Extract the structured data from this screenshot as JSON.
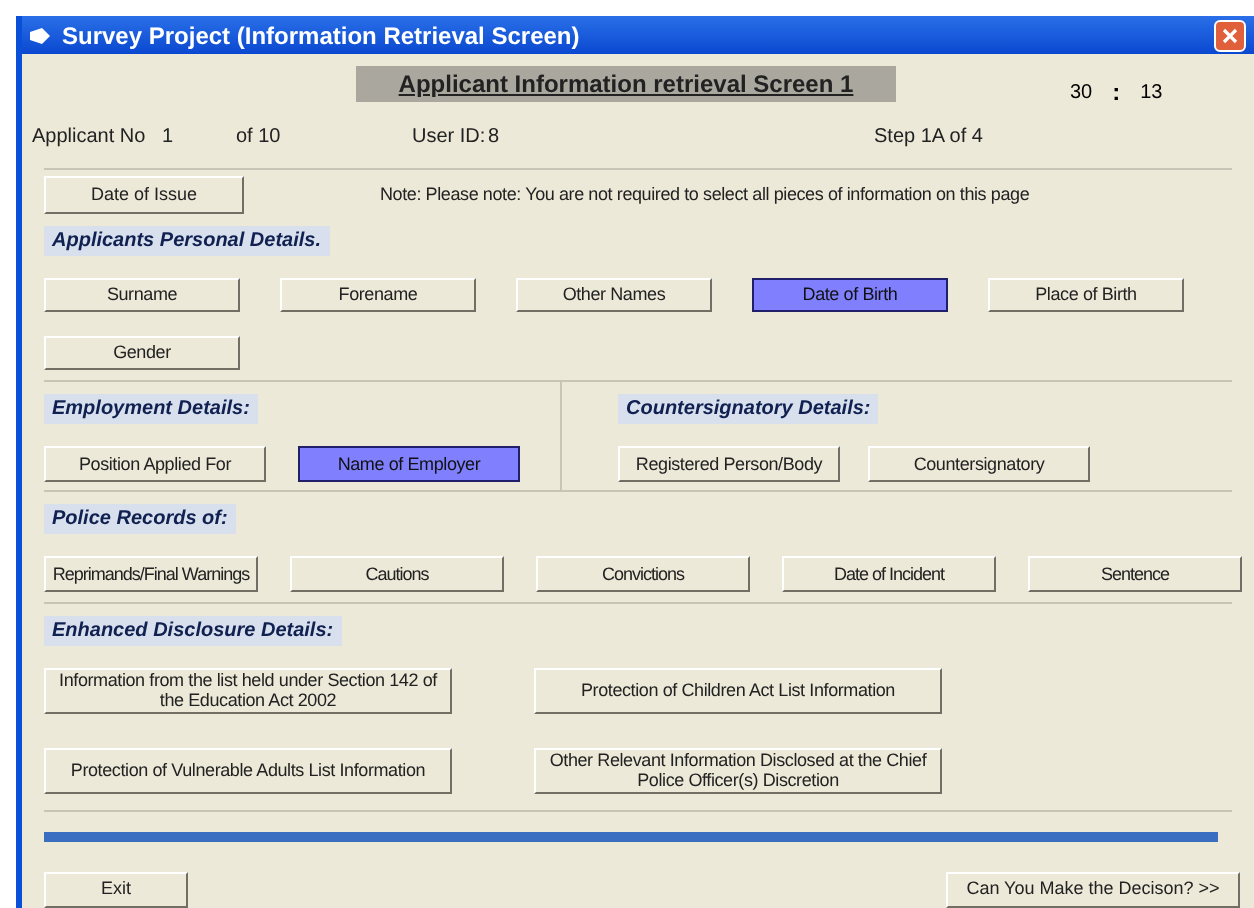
{
  "window": {
    "title": "Survey Project (Information Retrieval Screen)"
  },
  "header": {
    "title": "Applicant Information retrieval Screen 1",
    "time": [
      "30",
      ":",
      "13"
    ]
  },
  "info": {
    "applicant_no_label": "Applicant No",
    "applicant_no": "1",
    "of": "of 10",
    "user_id_label": "User ID:",
    "user_id": "8",
    "step": "Step 1A of 4"
  },
  "date_of_issue": {
    "label": "Date of Issue",
    "selected": false
  },
  "note": "Note: Please note: You are not required to select all pieces of information on this page",
  "personal": {
    "label": "Applicants Personal Details.",
    "buttons": [
      {
        "label": "Surname",
        "selected": false
      },
      {
        "label": "Forename",
        "selected": false
      },
      {
        "label": "Other Names",
        "selected": false
      },
      {
        "label": "Date of Birth",
        "selected": true
      },
      {
        "label": "Place of Birth",
        "selected": false
      },
      {
        "label": "Gender",
        "selected": false
      }
    ]
  },
  "employment": {
    "label": "Employment Details:",
    "buttons": [
      {
        "label": "Position Applied For",
        "selected": false
      },
      {
        "label": "Name of Employer",
        "selected": true
      }
    ]
  },
  "countersignatory": {
    "label": "Countersignatory Details:",
    "buttons": [
      {
        "label": "Registered Person/Body",
        "selected": false
      },
      {
        "label": "Countersignatory",
        "selected": false
      }
    ]
  },
  "police": {
    "label": "Police Records of:",
    "buttons": [
      {
        "label": "Reprimands/Final Warnings",
        "selected": false
      },
      {
        "label": "Cautions",
        "selected": false
      },
      {
        "label": "Convictions",
        "selected": false
      },
      {
        "label": "Date of Incident",
        "selected": false
      },
      {
        "label": "Sentence",
        "selected": false
      }
    ]
  },
  "enhanced": {
    "label": "Enhanced Disclosure Details:",
    "buttons": [
      {
        "label": "Information from the list held under Section 142 of the Education Act 2002",
        "selected": false
      },
      {
        "label": "Protection of Children Act List Information",
        "selected": false
      },
      {
        "label": "Protection of Vulnerable Adults List Information",
        "selected": false
      },
      {
        "label": "Other Relevant Information Disclosed at the Chief Police Officer(s) Discretion",
        "selected": false
      }
    ]
  },
  "progress": {
    "level": 1
  },
  "footer": {
    "exit": "Exit",
    "next": "Can You Make the Decison? >>"
  }
}
